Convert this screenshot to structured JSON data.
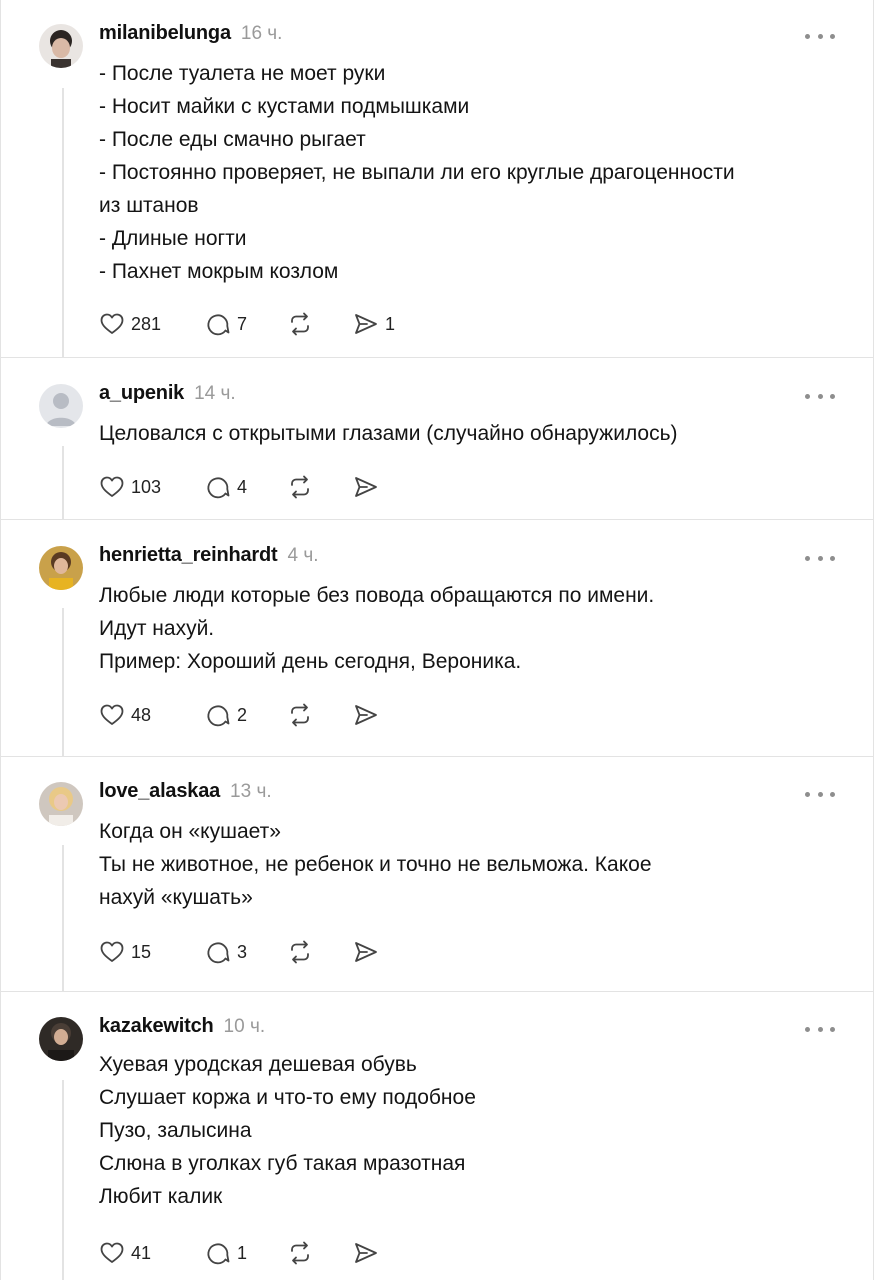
{
  "posts": [
    {
      "username": "milanibelunga",
      "time": "16 ч.",
      "lines": [
        "- После туалета не моет руки",
        "- Носит майки с кустами подмышками",
        "- После еды смачно рыгает",
        "- Постоянно проверяет, не выпали ли его круглые драгоценности",
        "из штанов",
        "- Длиные ногти",
        "- Пахнет мокрым козлом"
      ],
      "likes": "281",
      "comments": "7",
      "shares": "1"
    },
    {
      "username": "a_upenik",
      "time": "14 ч.",
      "lines": [
        "Целовался с открытыми глазами (случайно обнаружилось)"
      ],
      "likes": "103",
      "comments": "4",
      "shares": ""
    },
    {
      "username": "henrietta_reinhardt",
      "time": "4 ч.",
      "lines": [
        "Любые люди которые без повода обращаются по имени.",
        "Идут нахуй.",
        "Пример: Хороший день сегодня, Вероника."
      ],
      "likes": "48",
      "comments": "2",
      "shares": ""
    },
    {
      "username": "love_alaskaa",
      "time": "13 ч.",
      "lines": [
        "Когда он «кушает»",
        "Ты не животное, не ребенок и точно не вельможа. Какое",
        "нахуй «кушать»"
      ],
      "likes": "15",
      "comments": "3",
      "shares": ""
    },
    {
      "username": "kazakewitch",
      "time": "10 ч.",
      "lines": [
        "Хуевая уродская дешевая обувь",
        "Слушает коржа и что-то ему подобное",
        "Пузо, залысина",
        "Слюна в уголках губ такая мразотная",
        "Любит калик"
      ],
      "likes": "41",
      "comments": "1",
      "shares": ""
    }
  ],
  "icons": {
    "more": "more-icon",
    "like": "heart-icon",
    "comment": "comment-icon",
    "repost": "repost-icon",
    "share": "send-icon"
  },
  "colors": {
    "muted": "#9a9a9a",
    "divider": "#e3e3e3"
  }
}
